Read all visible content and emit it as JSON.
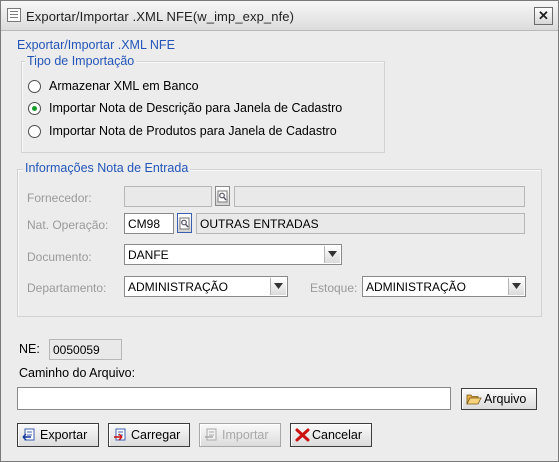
{
  "window": {
    "title": "Exportar/Importar .XML NFE(w_imp_exp_nfe)",
    "close_label": "✕"
  },
  "form": {
    "title": "Exportar/Importar .XML NFE"
  },
  "import_type": {
    "legend": "Tipo de Importação",
    "options": [
      {
        "label": "Armazenar XML em Banco",
        "selected": false
      },
      {
        "label": "Importar Nota de Descrição para Janela de Cadastro",
        "selected": true
      },
      {
        "label": "Importar Nota de Produtos para Janela de Cadastro",
        "selected": false
      }
    ]
  },
  "entry_info": {
    "legend": "Informações Nota de Entrada",
    "fornecedor": {
      "label": "Fornecedor:",
      "code": "",
      "name": ""
    },
    "nat_operacao": {
      "label": "Nat. Operação:",
      "code": "CM98",
      "description": "OUTRAS ENTRADAS"
    },
    "documento": {
      "label": "Documento:",
      "value": "DANFE"
    },
    "departamento": {
      "label": "Departamento:",
      "value": "ADMINISTRAÇÃO"
    },
    "estoque": {
      "label": "Estoque:",
      "value": "ADMINISTRAÇÃO"
    }
  },
  "ne": {
    "label": "NE:",
    "value": "0050059"
  },
  "file_path": {
    "label": "Caminho do Arquivo:",
    "value": ""
  },
  "buttons": {
    "arquivo": "Arquivo",
    "exportar": "Exportar",
    "carregar": "Carregar",
    "importar": "Importar",
    "cancelar": "Cancelar"
  },
  "colors": {
    "legend_blue": "#2355b8",
    "window_bg": "#ececec",
    "radio_selected": "#1b9c2a",
    "cancel_red": "#cc1111"
  }
}
